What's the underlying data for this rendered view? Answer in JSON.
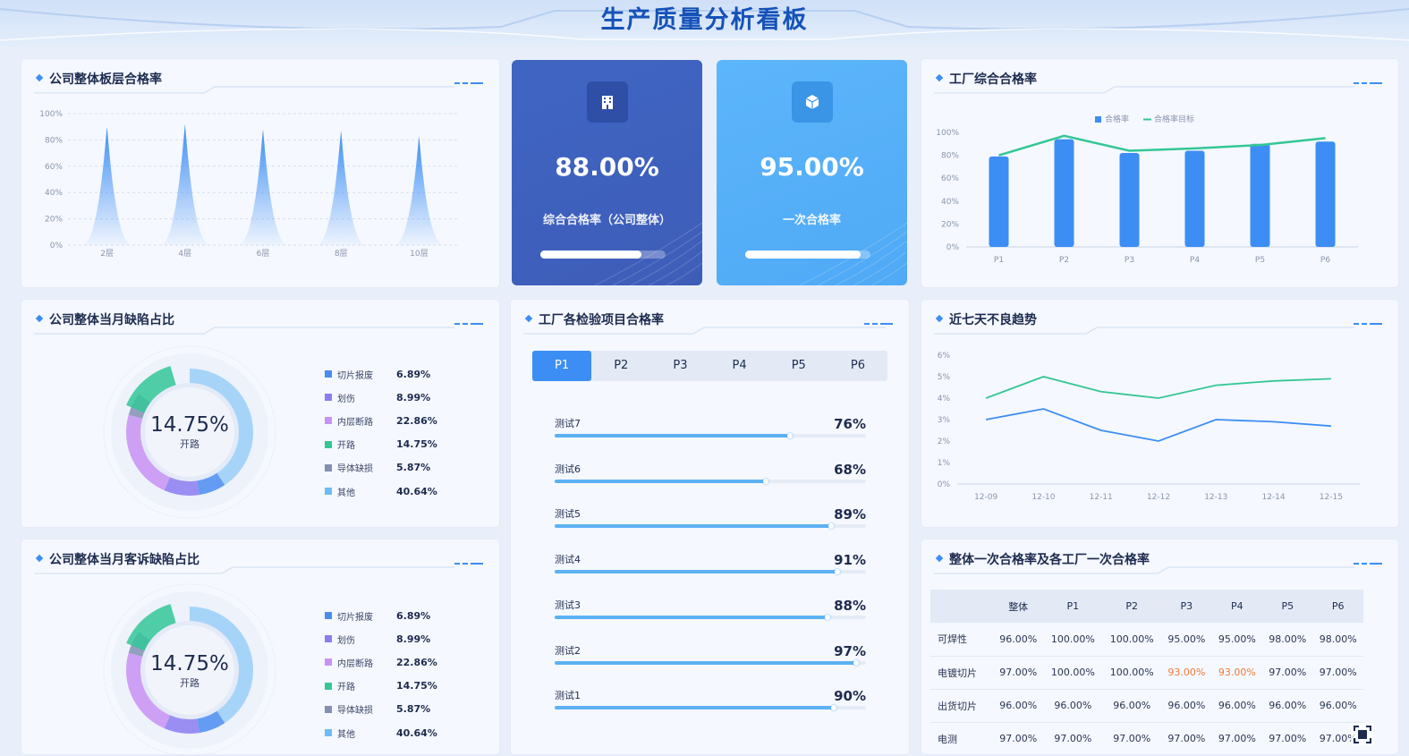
{
  "page": {
    "title": "生产质量分析看板"
  },
  "panels": {
    "floor_rate": {
      "title": "公司整体板层合格率"
    },
    "kpi_overall": {
      "value": "88.00%",
      "label": "综合合格率（公司整体）",
      "progress": 0.88
    },
    "kpi_first": {
      "value": "95.00%",
      "label": "一次合格率",
      "progress": 0.95
    },
    "factory_rate": {
      "title": "工厂综合合格率"
    },
    "defect_share": {
      "title": "公司整体当月缺陷占比"
    },
    "inspection": {
      "title": "工厂各检验项目合格率"
    },
    "trend": {
      "title": "近七天不良趋势"
    },
    "complaint_share": {
      "title": "公司整体当月客诉缺陷占比"
    },
    "first_pass_table": {
      "title": "整体一次合格率及各工厂一次合格率"
    }
  },
  "donut_defect": {
    "center_value": "14.75%",
    "center_label": "开路",
    "items": [
      {
        "name": "切片报废",
        "pct": "6.89%",
        "value": 6.89,
        "color": "#4a8df0"
      },
      {
        "name": "划伤",
        "pct": "8.99%",
        "value": 8.99,
        "color": "#8b7cf0"
      },
      {
        "name": "内层断路",
        "pct": "22.86%",
        "value": 22.86,
        "color": "#c792f5"
      },
      {
        "name": "开路",
        "pct": "14.75%",
        "value": 14.75,
        "color": "#33c796"
      },
      {
        "name": "导体缺损",
        "pct": "5.87%",
        "value": 5.87,
        "color": "#8390b4"
      },
      {
        "name": "其他",
        "pct": "40.64%",
        "value": 40.64,
        "color": "#6bbcf7"
      }
    ]
  },
  "donut_complaint": {
    "center_value": "14.75%",
    "center_label": "开路",
    "items": [
      {
        "name": "切片报废",
        "pct": "6.89%",
        "value": 6.89,
        "color": "#4a8df0"
      },
      {
        "name": "划伤",
        "pct": "8.99%",
        "value": 8.99,
        "color": "#8b7cf0"
      },
      {
        "name": "内层断路",
        "pct": "22.86%",
        "value": 22.86,
        "color": "#c792f5"
      },
      {
        "name": "开路",
        "pct": "14.75%",
        "value": 14.75,
        "color": "#33c796"
      },
      {
        "name": "导体缺损",
        "pct": "5.87%",
        "value": 5.87,
        "color": "#8390b4"
      },
      {
        "name": "其他",
        "pct": "40.64%",
        "value": 40.64,
        "color": "#6bbcf7"
      }
    ]
  },
  "inspection": {
    "tabs": [
      "P1",
      "P2",
      "P3",
      "P4",
      "P5",
      "P6"
    ],
    "active_tab": 0,
    "items": [
      {
        "label": "测试7",
        "pct": "76%",
        "value": 0.76
      },
      {
        "label": "测试6",
        "pct": "68%",
        "value": 0.68
      },
      {
        "label": "测试5",
        "pct": "89%",
        "value": 0.89
      },
      {
        "label": "测试4",
        "pct": "91%",
        "value": 0.91
      },
      {
        "label": "测试3",
        "pct": "88%",
        "value": 0.88
      },
      {
        "label": "测试2",
        "pct": "97%",
        "value": 0.97
      },
      {
        "label": "测试1",
        "pct": "90%",
        "value": 0.9
      }
    ]
  },
  "table": {
    "headers": [
      "",
      "整体",
      "P1",
      "P2",
      "P3",
      "P4",
      "P5",
      "P6"
    ],
    "rows": [
      {
        "name": "可焊性",
        "cells": [
          "96.00%",
          "100.00%",
          "100.00%",
          "95.00%",
          "95.00%",
          "98.00%",
          "98.00%"
        ],
        "warn": []
      },
      {
        "name": "电镀切片",
        "cells": [
          "97.00%",
          "100.00%",
          "100.00%",
          "93.00%",
          "93.00%",
          "97.00%",
          "97.00%"
        ],
        "warn": [
          3,
          4
        ]
      },
      {
        "name": "出货切片",
        "cells": [
          "96.00%",
          "96.00%",
          "96.00%",
          "96.00%",
          "96.00%",
          "96.00%",
          "96.00%"
        ],
        "warn": []
      },
      {
        "name": "电测",
        "cells": [
          "97.00%",
          "97.00%",
          "97.00%",
          "97.00%",
          "97.00%",
          "97.00%",
          "97.00%"
        ],
        "warn": []
      }
    ]
  },
  "chart_data": [
    {
      "type": "area",
      "title": "公司整体板层合格率",
      "x": [
        "2层",
        "4层",
        "6层",
        "8层",
        "10层"
      ],
      "values": [
        90,
        92,
        88,
        87,
        83
      ],
      "yticks": [
        "100%",
        "80%",
        "60%",
        "40%",
        "20%",
        "0%"
      ],
      "ylim": [
        0,
        100
      ],
      "grid": true,
      "color": "#3c8ef5"
    },
    {
      "type": "bar",
      "title": "工厂综合合格率",
      "categories": [
        "P1",
        "P2",
        "P3",
        "P4",
        "P5",
        "P6"
      ],
      "series": [
        {
          "name": "合格率",
          "values": [
            79,
            94,
            82,
            84,
            90,
            92
          ],
          "color": "#3c8ef5"
        },
        {
          "name": "合格率目标",
          "values": [
            80,
            97,
            84,
            86,
            89,
            95
          ],
          "color": "#33c796"
        }
      ],
      "yticks": [
        "100%",
        "80%",
        "60%",
        "40%",
        "20%",
        "0%"
      ],
      "ylim": [
        0,
        100
      ],
      "legend": "top-center"
    },
    {
      "type": "line",
      "title": "近七天不良趋势",
      "categories": [
        "12-09",
        "12-10",
        "12-11",
        "12-12",
        "12-13",
        "12-14",
        "12-15"
      ],
      "series": [
        {
          "values": [
            4.0,
            5.0,
            4.3,
            4.0,
            4.6,
            4.8,
            4.9
          ],
          "color": "#33c796"
        },
        {
          "values": [
            3.0,
            3.5,
            2.5,
            2.0,
            3.0,
            2.9,
            2.7
          ],
          "color": "#3c8ef5"
        }
      ],
      "yticks": [
        "6%",
        "5%",
        "4%",
        "3%",
        "2%",
        "1%",
        "0%"
      ],
      "ylim": [
        0,
        6
      ],
      "grid": true
    }
  ]
}
